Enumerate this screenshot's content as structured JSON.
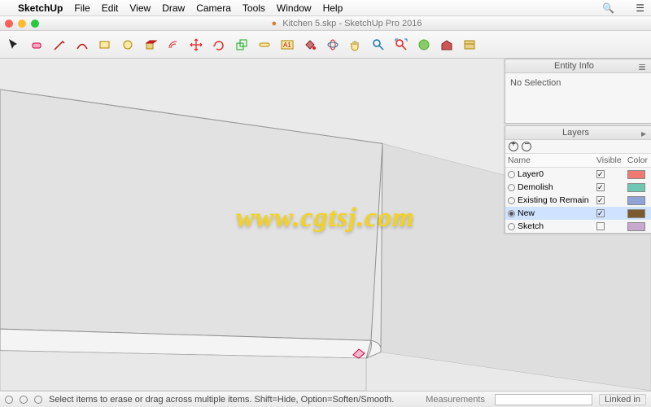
{
  "menubar": {
    "app": "SketchUp",
    "items": [
      "File",
      "Edit",
      "View",
      "Draw",
      "Camera",
      "Tools",
      "Window",
      "Help"
    ]
  },
  "window": {
    "modified": "●",
    "title": "Kitchen 5.skp - SketchUp Pro 2016"
  },
  "toolbar": {
    "tools": [
      {
        "name": "select-tool",
        "glyph": "arrow"
      },
      {
        "name": "eraser-tool",
        "glyph": "eraser"
      },
      {
        "name": "line-tool",
        "glyph": "pencil"
      },
      {
        "name": "arc-tool",
        "glyph": "arc"
      },
      {
        "name": "rectangle-tool",
        "glyph": "rect"
      },
      {
        "name": "circle-tool",
        "glyph": "circle"
      },
      {
        "name": "pushpull-tool",
        "glyph": "pushpull"
      },
      {
        "name": "offset-tool",
        "glyph": "offset"
      },
      {
        "name": "move-tool",
        "glyph": "move"
      },
      {
        "name": "rotate-tool",
        "glyph": "rotate"
      },
      {
        "name": "scale-tool",
        "glyph": "scale"
      },
      {
        "name": "tape-tool",
        "glyph": "tape"
      },
      {
        "name": "text-tool",
        "glyph": "text"
      },
      {
        "name": "paint-tool",
        "glyph": "bucket"
      },
      {
        "name": "orbit-tool",
        "glyph": "orbit"
      },
      {
        "name": "pan-tool",
        "glyph": "pan"
      },
      {
        "name": "zoom-tool",
        "glyph": "zoom"
      },
      {
        "name": "zoomextents-tool",
        "glyph": "zoomext"
      },
      {
        "name": "addlocation-tool",
        "glyph": "geo"
      },
      {
        "name": "warehouse-tool",
        "glyph": "wh"
      },
      {
        "name": "extensions-tool",
        "glyph": "ext"
      }
    ]
  },
  "panels": {
    "entity": {
      "title": "Entity Info",
      "selection": "No Selection"
    },
    "layers": {
      "title": "Layers",
      "columns": [
        "Name",
        "Visible",
        "Color"
      ],
      "rows": [
        {
          "name": "Layer0",
          "visible": true,
          "color": "#ef7a72",
          "active": false
        },
        {
          "name": "Demolish",
          "visible": true,
          "color": "#6ec7b3",
          "active": false
        },
        {
          "name": "Existing to Remain",
          "visible": true,
          "color": "#8fa3d6",
          "active": false
        },
        {
          "name": "New",
          "visible": true,
          "color": "#7a5a2e",
          "active": true
        },
        {
          "name": "Sketch",
          "visible": false,
          "color": "#c7a9cf",
          "active": false
        }
      ]
    }
  },
  "status": {
    "hint": "Select items to erase or drag across multiple items. Shift=Hide, Option=Soften/Smooth.",
    "measure_label": "Measurements",
    "brand": "Linked in"
  },
  "watermark": "www.cgtsj.com"
}
